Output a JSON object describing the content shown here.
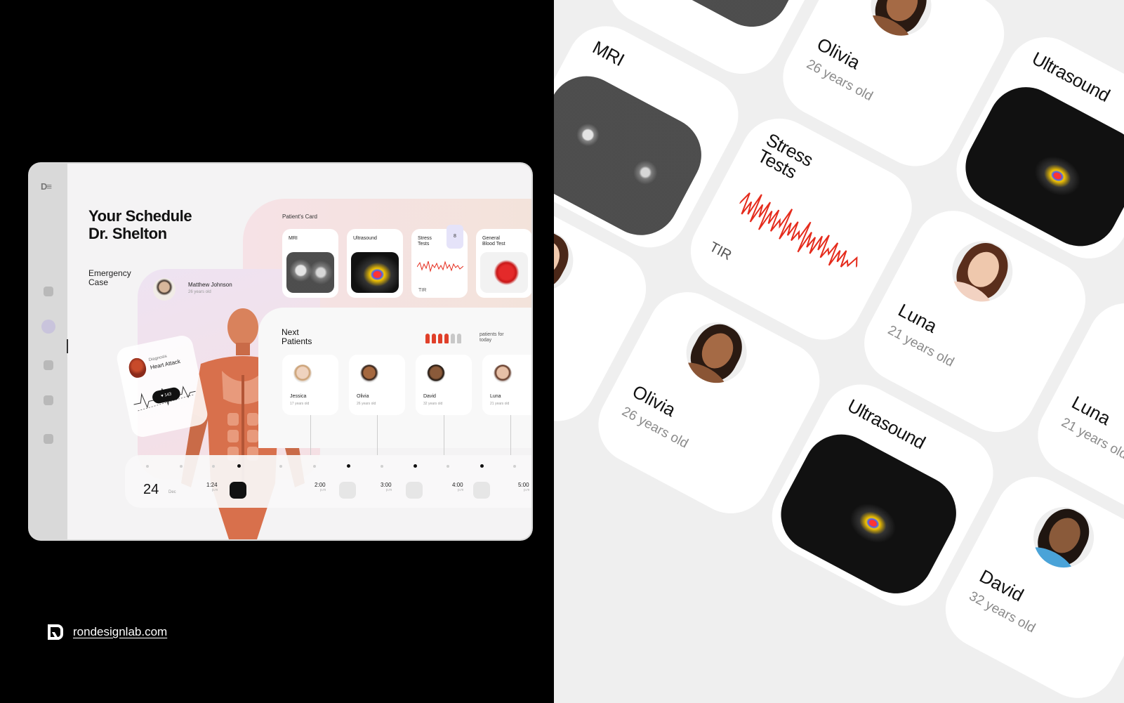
{
  "device": {
    "title_line1": "Your Schedule",
    "title_line2": "Dr. Shelton",
    "emergency_label_line1": "Emergency",
    "emergency_label_line2": "Case",
    "emergency_patient": {
      "name": "Matthew Johnson",
      "age": "26 years old"
    },
    "patient_card_label": "Patient's Card",
    "cards": [
      {
        "title": "MRI",
        "kind": "mri"
      },
      {
        "title": "Ultrasound",
        "kind": "ultrasound"
      },
      {
        "title_line1": "Stress",
        "title_line2": "Tests",
        "badge": "8",
        "caption": "TIR",
        "kind": "stress"
      },
      {
        "title_line1": "General",
        "title_line2": "Blood Test",
        "kind": "blood"
      }
    ],
    "next_patients_line1": "Next",
    "next_patients_line2": "Patients",
    "patients_today_line1": "patients for",
    "patients_today_line2": "today",
    "patients_active": 4,
    "patients_total": 6,
    "next_patients": [
      {
        "name": "Jessica",
        "age": "17 years old"
      },
      {
        "name": "Olivia",
        "age": "26 years old"
      },
      {
        "name": "David",
        "age": "32 years old"
      },
      {
        "name": "Luna",
        "age": "21 years old"
      }
    ],
    "diagnosis": {
      "label": "Diagnosis",
      "value": "Heart Attack",
      "bpm": "143"
    },
    "timeline": {
      "day": "24",
      "month": "Dec",
      "slots": [
        {
          "time": "1:24",
          "period": "p.m"
        },
        {
          "time": "2:00",
          "period": "p.m"
        },
        {
          "time": "3:00",
          "period": "p.m"
        },
        {
          "time": "4:00",
          "period": "p.m"
        },
        {
          "time": "5:00",
          "period": "p.m"
        }
      ]
    }
  },
  "brand": {
    "url": "rondesignlab.com"
  },
  "right_cards": {
    "mri": "MRI",
    "ultrasound": "Ultrasound",
    "stress_line1": "Stress",
    "stress_line2": "Tests",
    "tir": "TIR",
    "olivia": {
      "name": "Olivia",
      "age": "26 years old"
    },
    "luna": {
      "name": "Luna",
      "age": "21 years old"
    },
    "david": {
      "name": "David",
      "age": "32 years old"
    }
  },
  "colors": {
    "accent_red": "#e0402a",
    "badge_lavender": "#e5e3f9",
    "background_dark": "#000000",
    "card_bg": "#ffffff",
    "panel_bg": "#efefef"
  },
  "icons": [
    "home-icon",
    "calendar-icon",
    "patients-icon",
    "notifications-icon",
    "settings-icon",
    "heart-icon",
    "person-icon"
  ]
}
